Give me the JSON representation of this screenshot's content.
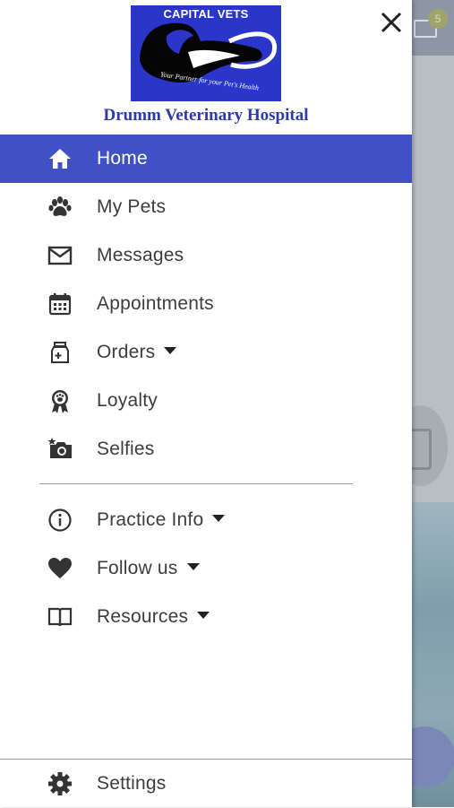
{
  "drawer": {
    "logo": {
      "title": "CAPITAL VETS",
      "tagline": "Your Partner for your Pet's Health"
    },
    "hospital_name": "Drumm Veterinary Hospital",
    "menu_primary": [
      {
        "label": "Home",
        "icon": "home-icon",
        "active": true
      },
      {
        "label": "My Pets",
        "icon": "paw-icon"
      },
      {
        "label": "Messages",
        "icon": "envelope-icon"
      },
      {
        "label": "Appointments",
        "icon": "calendar-icon"
      },
      {
        "label": "Orders",
        "icon": "medicine-jar-icon",
        "dropdown": true
      },
      {
        "label": "Loyalty",
        "icon": "award-ribbon-icon"
      },
      {
        "label": "Selfies",
        "icon": "camera-icon"
      }
    ],
    "menu_secondary": [
      {
        "label": "Practice Info",
        "icon": "info-icon",
        "dropdown": true
      },
      {
        "label": "Follow us",
        "icon": "heart-icon",
        "dropdown": true
      },
      {
        "label": "Resources",
        "icon": "book-icon",
        "dropdown": true
      }
    ],
    "footer": {
      "label": "Settings",
      "icon": "gear-icon"
    }
  },
  "background": {
    "message_badge_count": "5"
  },
  "colors": {
    "active_bg": "#3f51c4",
    "logo_bg": "#2936c9",
    "hospital_name": "#2e3aa8"
  }
}
